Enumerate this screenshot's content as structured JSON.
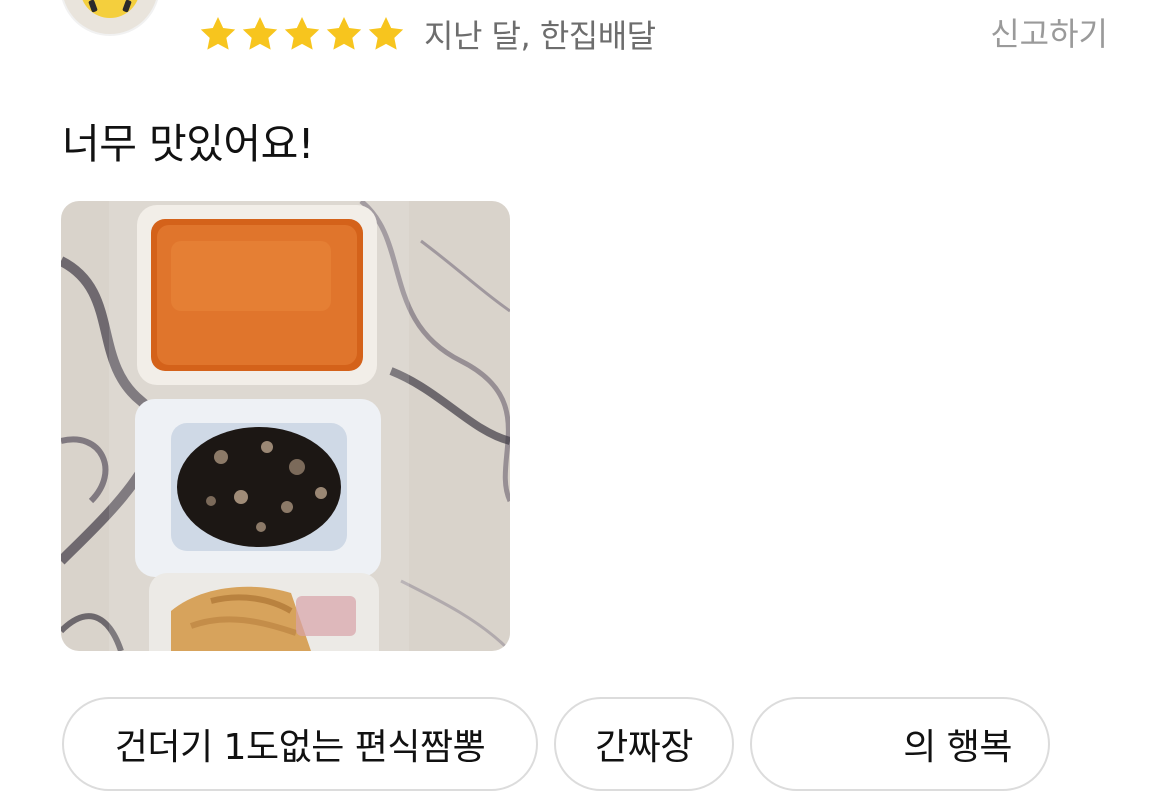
{
  "review": {
    "rating": 5,
    "rating_max": 5,
    "meta": "지난 달, 한집배달",
    "report_label": "신고하기",
    "text": "너무 맛있어요!",
    "photo_icon": "food-photo"
  },
  "tags": [
    {
      "label": "건더기 1도없는 편식짬뽕"
    },
    {
      "label": "간짜장"
    },
    {
      "label": "의 행복"
    }
  ],
  "colors": {
    "star": "#F7C51E",
    "meta_text": "#6D6D6D",
    "report_text": "#9A9A9A",
    "chip_border": "#DCDCDC"
  }
}
